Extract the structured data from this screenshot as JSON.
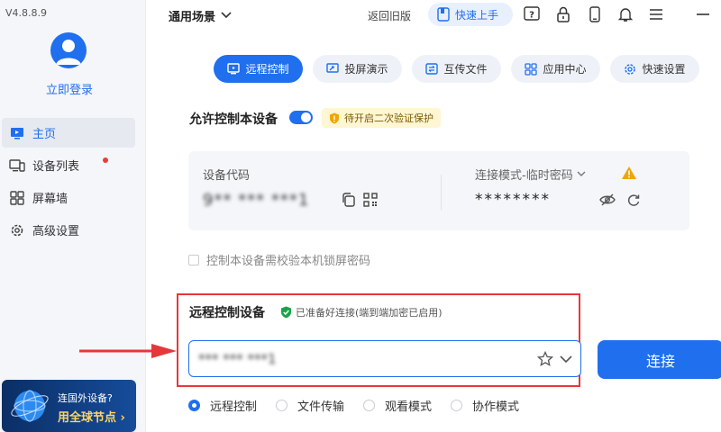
{
  "sidebar": {
    "version": "V4.8.8.9",
    "login": "立即登录",
    "items": [
      {
        "label": "主页",
        "icon": "monitor-icon",
        "active": true
      },
      {
        "label": "设备列表",
        "icon": "devices-icon",
        "badge": true
      },
      {
        "label": "屏幕墙",
        "icon": "grid-icon"
      },
      {
        "label": "高级设置",
        "icon": "gear-icon"
      }
    ],
    "promo": {
      "line1": "连国外设备?",
      "line2": "用全球节点 ›"
    }
  },
  "topbar": {
    "scene": "通用场景",
    "old_version": "返回旧版",
    "quick_start": "快速上手",
    "icons": [
      "help-icon",
      "lock-icon",
      "phone-icon",
      "bell-icon",
      "menu-icon",
      "minimize-icon"
    ]
  },
  "tabs": [
    {
      "label": "远程控制",
      "icon": "remote-icon",
      "active": true
    },
    {
      "label": "投屏演示",
      "icon": "cast-icon"
    },
    {
      "label": "互传文件",
      "icon": "file-transfer-icon"
    },
    {
      "label": "应用中心",
      "icon": "apps-icon"
    },
    {
      "label": "快速设置",
      "icon": "gear-icon"
    }
  ],
  "allow": {
    "title": "允许控制本设备",
    "toggle_on": true,
    "badge": "待开启二次验证保护"
  },
  "device": {
    "code_label": "设备代码",
    "code_value": "9** *** ***1",
    "mode_label": "连接模式-临时密码",
    "password": "********"
  },
  "lock_option": "控制本设备需校验本机锁屏密码",
  "remote": {
    "title": "远程控制设备",
    "status": "已准备好连接(端到端加密已启用)",
    "input_value": "*** *** ***1",
    "connect": "连接"
  },
  "modes": [
    {
      "label": "远程控制",
      "checked": true
    },
    {
      "label": "文件传输",
      "checked": false
    },
    {
      "label": "观看模式",
      "checked": false
    },
    {
      "label": "协作模式",
      "checked": false
    }
  ],
  "colors": {
    "accent": "#1f6fef",
    "highlight": "#e5383b",
    "warning": "#f0a500"
  }
}
